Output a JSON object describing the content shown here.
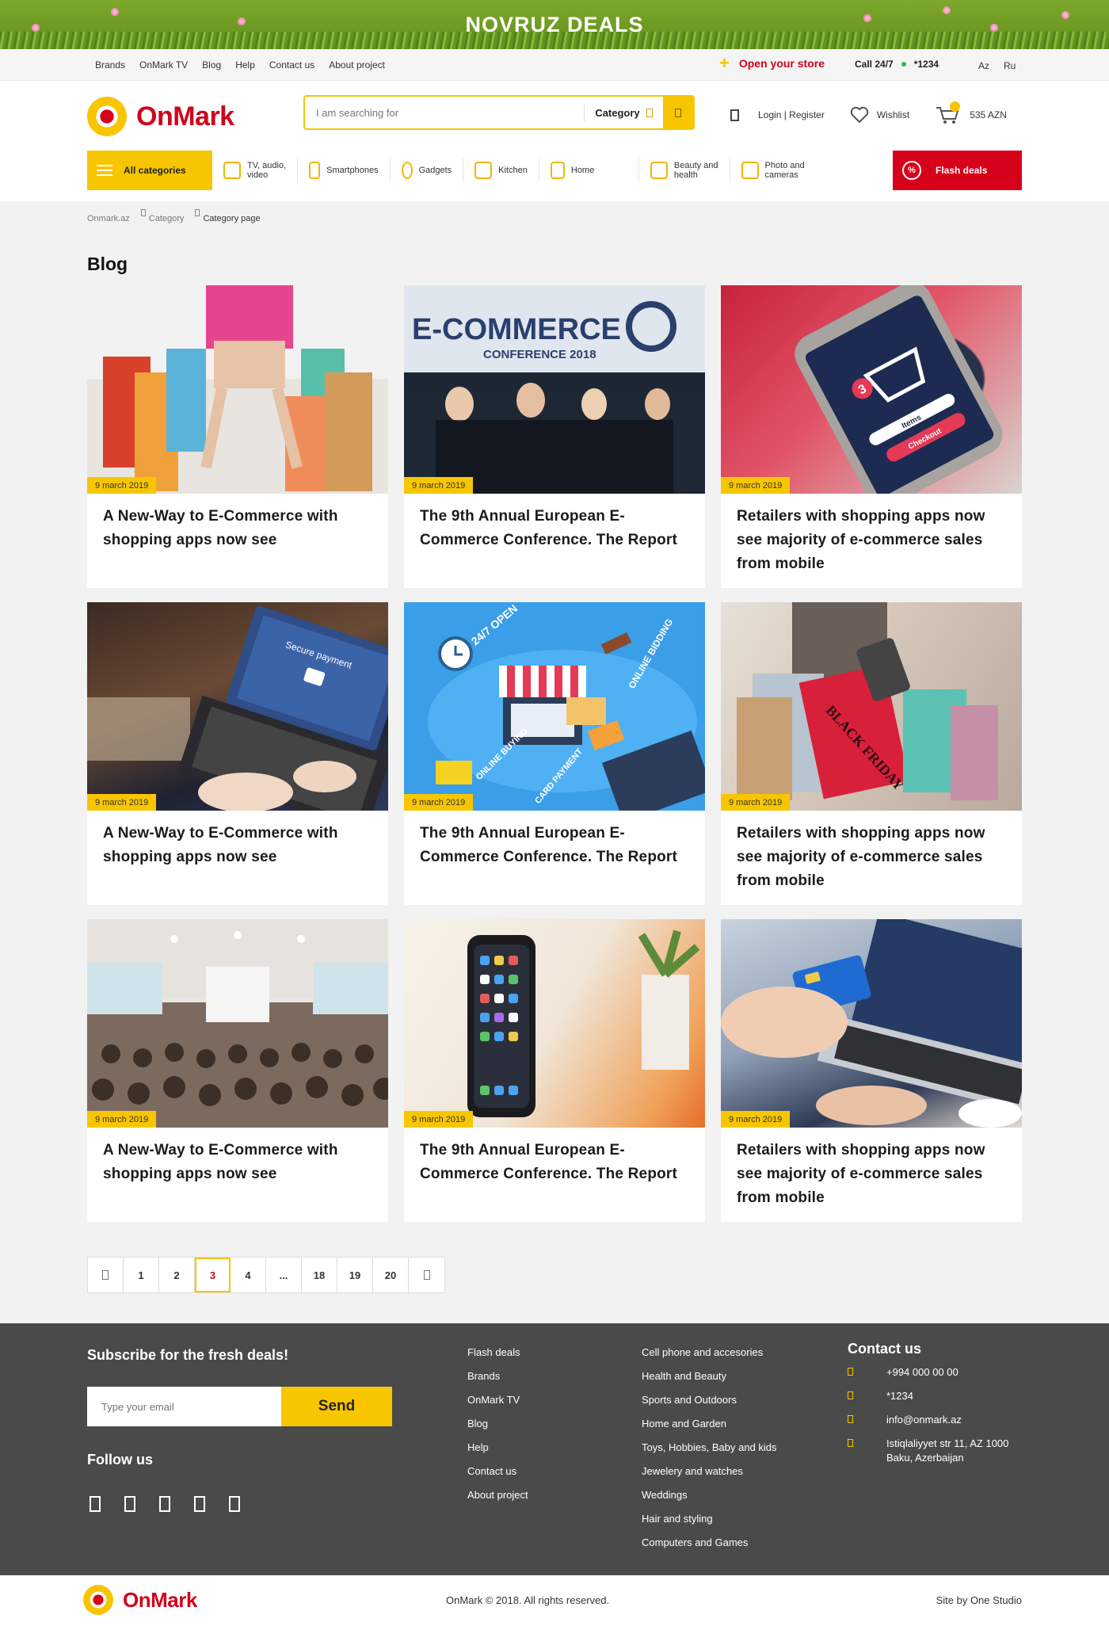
{
  "promo": {
    "title": "NOVRUZ DEALS"
  },
  "topbar": {
    "links": [
      "Brands",
      "OnMark TV",
      "Blog",
      "Help",
      "Contact us",
      "About project"
    ],
    "open_store": "Open your store",
    "call_label": "Call 24/7",
    "call_number": "*1234",
    "languages": [
      "Az",
      "Ru"
    ]
  },
  "header": {
    "logo": "OnMark",
    "search_placeholder": "I am searching for",
    "category_label": "Category",
    "login": "Login | Register",
    "wishlist": "Wishlist",
    "cart_total": "535 AZN"
  },
  "catnav": {
    "all": "All categories",
    "items": [
      {
        "l1": "TV, audio,",
        "l2": "video"
      },
      {
        "l1": "Smartphones",
        "l2": ""
      },
      {
        "l1": "Gadgets",
        "l2": ""
      },
      {
        "l1": "Kitchen",
        "l2": ""
      },
      {
        "l1": "Home",
        "l2": ""
      },
      {
        "l1": "Beauty and",
        "l2": "health"
      },
      {
        "l1": "Photo and",
        "l2": "cameras"
      }
    ],
    "flash": "Flash deals"
  },
  "breadcrumb": [
    "Onmark.az",
    "Category",
    "Category page"
  ],
  "page_title": "Blog",
  "posts": [
    {
      "date": "9 march 2019",
      "title": "A New-Way to E-Commerce with shopping apps now see"
    },
    {
      "date": "9 march 2019",
      "title": "The 9th Annual European E-Commerce Conference. The Report"
    },
    {
      "date": "9 march 2019",
      "title": "Retailers with shopping apps now see majority of e-commerce sales from mobile"
    },
    {
      "date": "9 march 2019",
      "title": "A New-Way to E-Commerce with shopping apps now see"
    },
    {
      "date": "9 march 2019",
      "title": "The 9th Annual European E-Commerce Conference. The Report"
    },
    {
      "date": "9 march 2019",
      "title": "Retailers with shopping apps now see majority of e-commerce sales from mobile"
    },
    {
      "date": "9 march 2019",
      "title": "A New-Way to E-Commerce with shopping apps now see"
    },
    {
      "date": "9 march 2019",
      "title": "The 9th Annual European E-Commerce Conference. The Report"
    },
    {
      "date": "9 march 2019",
      "title": "Retailers with shopping apps now see majority of e-commerce sales from mobile"
    }
  ],
  "image_text": {
    "conference_title": "E-COMMERCE",
    "conference_sub": "CONFERENCE 2018",
    "phone_cart_count": "3",
    "phone_items": "Items",
    "phone_checkout": "Checkout",
    "laptop_secure": "Secure payment",
    "iso_247": "24/7 OPEN",
    "iso_bidding": "ONLINE BIDDING",
    "iso_buying": "ONLINE BUYING",
    "iso_card": "CARD PAYMENT",
    "bag_text": "BLACK FRIDAY"
  },
  "pagination": {
    "pages": [
      "1",
      "2",
      "3",
      "4",
      "...",
      "18",
      "19",
      "20"
    ],
    "current": "3"
  },
  "footer": {
    "subscribe_title": "Subscribe for the fresh deals!",
    "email_placeholder": "Type your email",
    "send": "Send",
    "follow": "Follow us",
    "col1": [
      "Flash deals",
      "Brands",
      "OnMark TV",
      "Blog",
      "Help",
      "Contact us",
      "About project"
    ],
    "col2": [
      "Cell phone and accesories",
      "Health and Beauty",
      "Sports and Outdoors",
      "Home and Garden",
      "Toys, Hobbies, Baby and kids",
      "Jewelery and watches",
      "Weddings",
      "Hair and styling",
      "Computers and Games"
    ],
    "contact_title": "Contact us",
    "contacts": [
      "+994 000 00 00",
      "*1234",
      "info@onmark.az",
      "Istiqlaliyyet str 11, AZ 1000 Baku, Azerbaijan"
    ]
  },
  "bottom": {
    "logo": "OnMark",
    "copyright": "OnMark © 2018. All rights reserved.",
    "credit": "Site by One Studio"
  },
  "colors": {
    "accent": "#f7c600",
    "brand_red": "#d0021b",
    "footer_bg": "#4a4a4a"
  }
}
